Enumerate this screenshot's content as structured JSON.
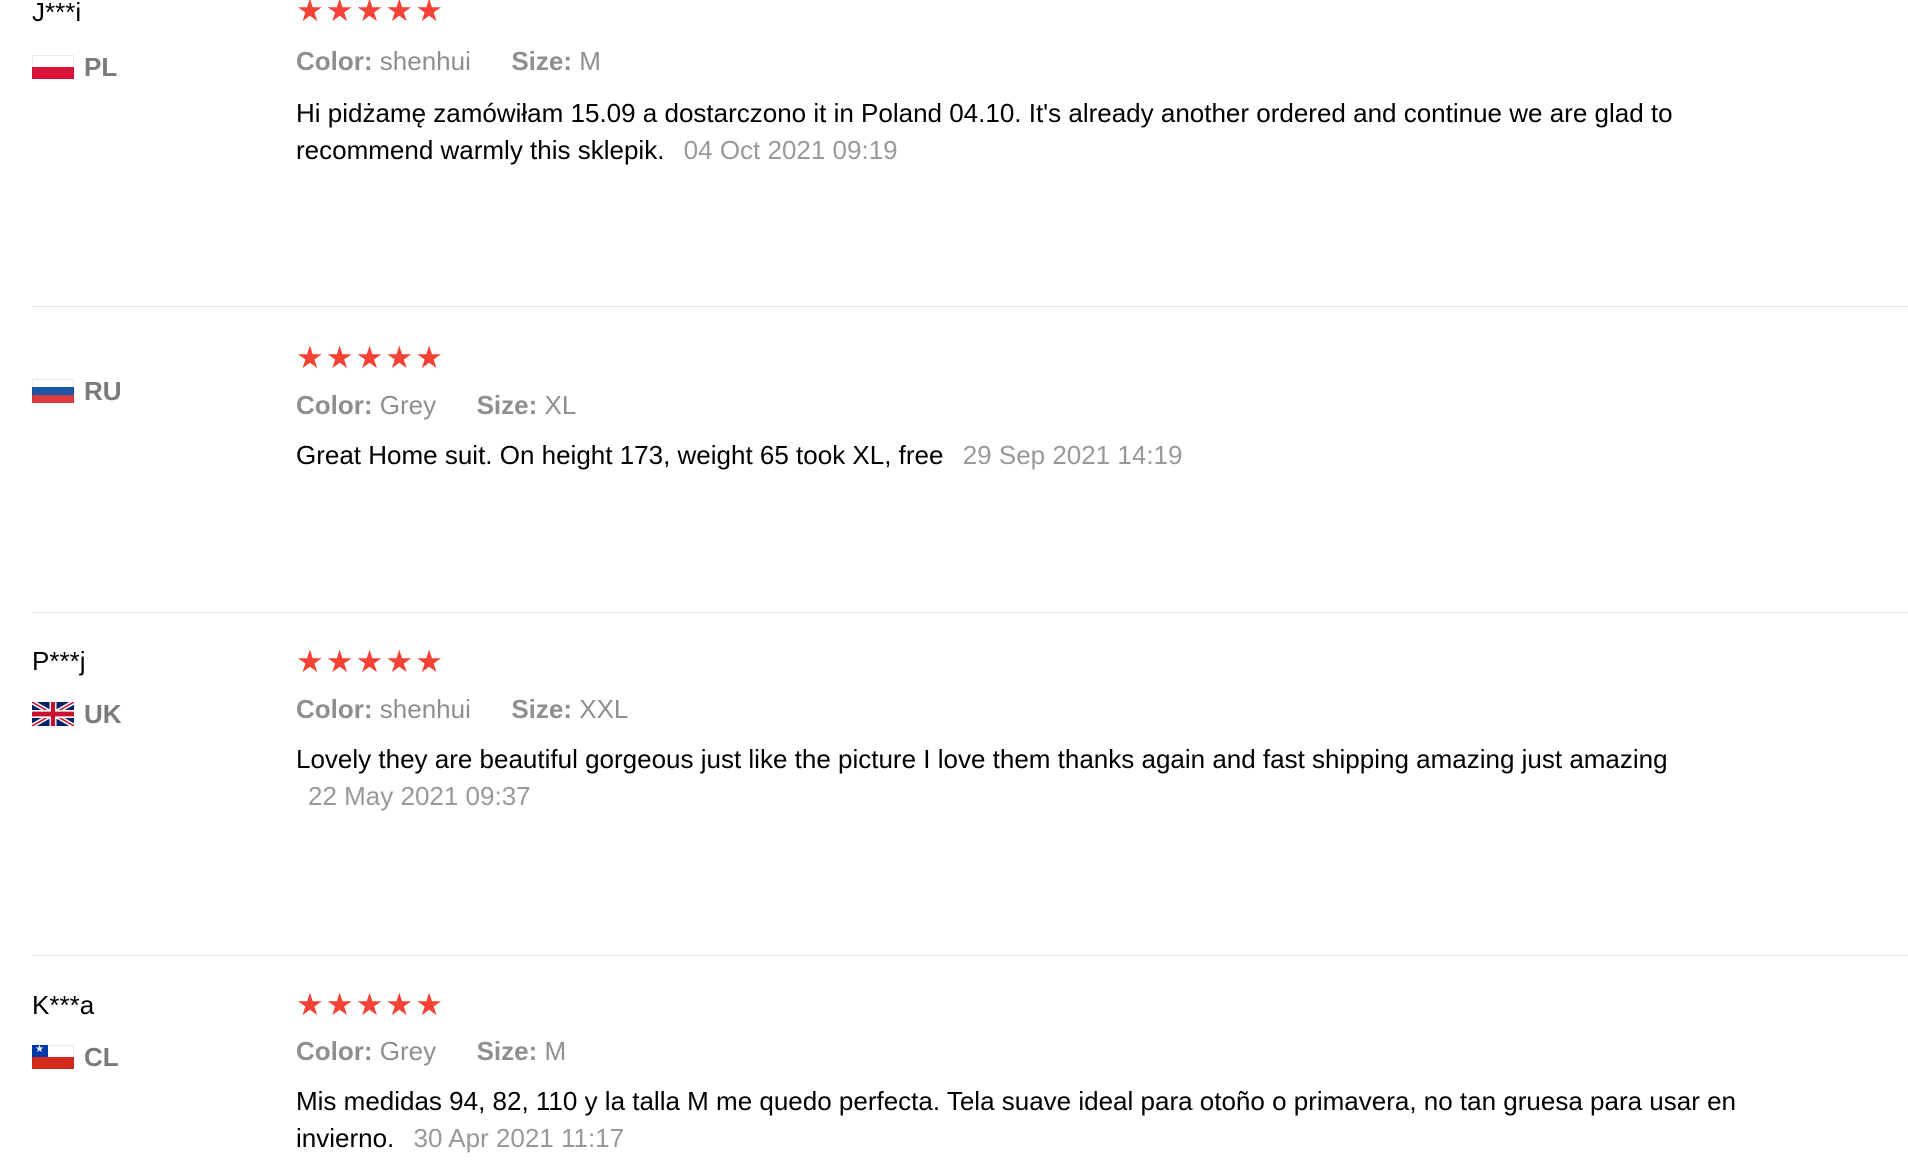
{
  "reviews": [
    {
      "name": "J***i",
      "country": "PL",
      "flag": "poland-flag-icon",
      "stars": 5,
      "color_label": "Color:",
      "color_value": "shenhui",
      "size_label": "Size:",
      "size_value": "M",
      "text": "Hi pidżamę zamówiłam 15.09 a dostarczono it in Poland 04.10. It's already another ordered and continue we are glad to recommend warmly this sklepik.",
      "date": "04 Oct 2021 09:19"
    },
    {
      "name": "",
      "country": "RU",
      "flag": "russia-flag-icon",
      "stars": 5,
      "color_label": "Color:",
      "color_value": "Grey",
      "size_label": "Size:",
      "size_value": "XL",
      "text": "Great Home suit. On height 173, weight 65 took XL, free",
      "date": "29 Sep 2021 14:19"
    },
    {
      "name": "P***j",
      "country": "UK",
      "flag": "uk-flag-icon",
      "stars": 5,
      "color_label": "Color:",
      "color_value": "shenhui",
      "size_label": "Size:",
      "size_value": "XXL",
      "text": "Lovely they are beautiful gorgeous just like the picture I love them thanks again and fast shipping amazing just amazing",
      "date": "22 May 2021 09:37"
    },
    {
      "name": "K***a",
      "country": "CL",
      "flag": "chile-flag-icon",
      "stars": 5,
      "color_label": "Color:",
      "color_value": "Grey",
      "size_label": "Size:",
      "size_value": "M",
      "text": "Mis medidas 94, 82, 110 y la talla M me quedo perfecta. Tela suave ideal para otoño o primavera, no tan gruesa para usar en invierno.",
      "date": "30 Apr 2021 11:17"
    }
  ],
  "star_glyph": "★",
  "colors": {
    "star": "#f44336",
    "muted_text": "#8f8f8f",
    "date_text": "#999999",
    "divider": "#e6e6e6"
  }
}
